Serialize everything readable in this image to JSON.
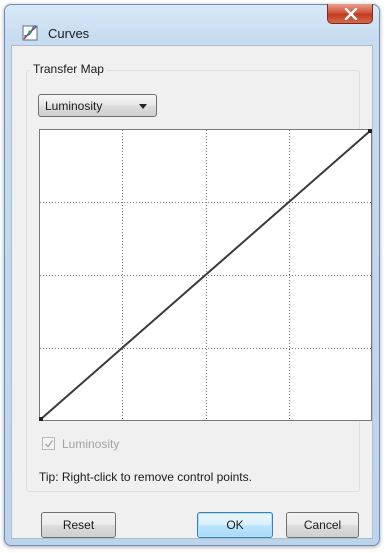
{
  "window": {
    "title": "Curves",
    "icon": "curves-icon",
    "close_icon": "close-icon"
  },
  "group": {
    "label": "Transfer Map"
  },
  "channel_select": {
    "value": "Luminosity",
    "icon": "chevron-down-icon"
  },
  "curve_editor": {
    "grid_divisions": 4,
    "control_points": [
      {
        "input": 0,
        "output": 0
      },
      {
        "input": 255,
        "output": 255
      }
    ],
    "line_color": "#3a3a3a",
    "grid_color": "#777777"
  },
  "channel_checkbox": {
    "label": "Luminosity",
    "checked": true,
    "enabled": false
  },
  "tip": "Tip: Right-click to remove control points.",
  "buttons": {
    "reset": "Reset",
    "ok": "OK",
    "cancel": "Cancel"
  },
  "colors": {
    "titlebar": "#c7dcf0",
    "close_button": "#c94a2f",
    "dialog_bg": "#f0f0f0",
    "ok_border": "#3c7fb1"
  }
}
